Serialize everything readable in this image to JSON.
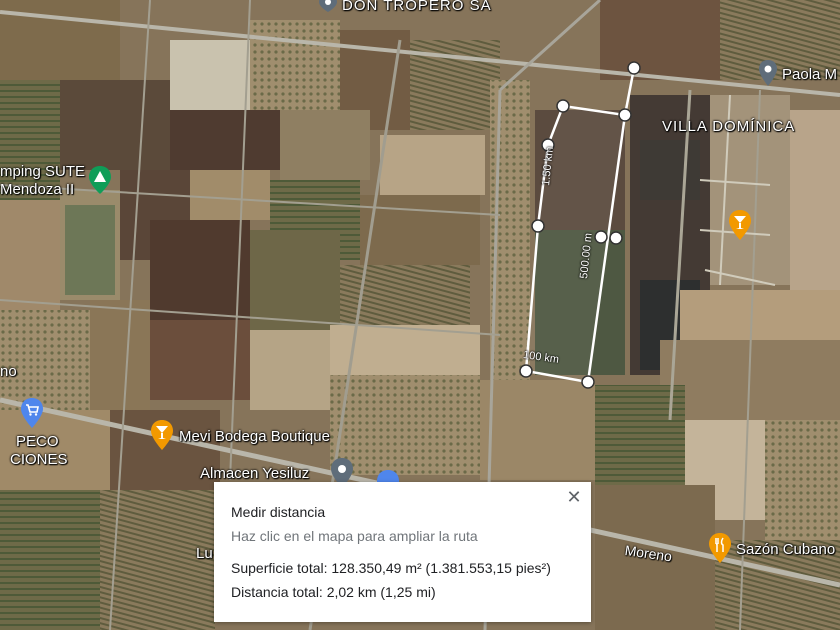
{
  "map": {
    "place_labels": {
      "don_tropero": "DON TROPERO SA",
      "paola": "Paola M",
      "villa_dominica": "VILLA DOMÍNICA",
      "camping_line1": "mping SUTE",
      "camping_line2": "Mendoza II",
      "left_no": "no",
      "peco_line1": "PECO",
      "peco_line2": "CIONES",
      "mevi": "Mevi Bodega Boutique",
      "almacen": "Almacen Yesiluz",
      "lu": "Lu",
      "moreno": "Moreno",
      "sazon": "Sazón Cubano"
    },
    "measure_labels": {
      "left_side": "1.50 km",
      "right_side": "500.00 m",
      "bottom_side": "100 km"
    },
    "icons": {
      "place_pin": "location-pin-icon",
      "camping": "camping-icon",
      "bar": "cocktail-bar-icon",
      "shopping": "shopping-cart-icon",
      "restaurant": "restaurant-icon"
    },
    "colors": {
      "pin_gray": "#5f6d7a",
      "pin_orange": "#f29900",
      "pin_blue": "#4f86ec",
      "pin_green": "#0f9d58"
    }
  },
  "panel": {
    "title": "Medir distancia",
    "subtitle": "Haz clic en el mapa para ampliar la ruta",
    "total_area": "Superficie total: 128.350,49 m² (1.381.553,15 pies²)",
    "total_distance": "Distancia total: 2,02 km (1,25 mi)",
    "close_symbol": "✕"
  }
}
